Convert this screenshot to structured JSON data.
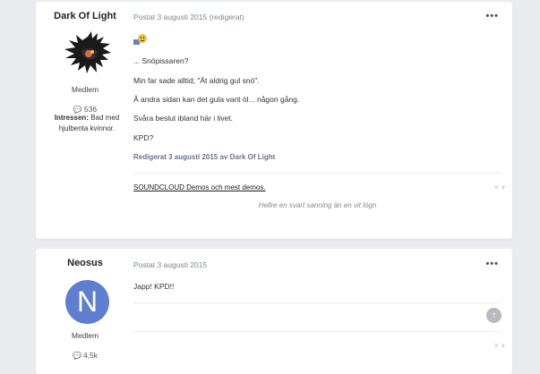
{
  "posts": [
    {
      "author": "Dark Of Light",
      "rank": "Medlem",
      "post_count": "536",
      "interests_label": "Intressen:",
      "interests_value": "Bad med hjulbenta kvinnor.",
      "meta": "Postat 3 augusti 2015 (redigerat)",
      "more": "•••",
      "lines": [
        "... Snöpissaren?",
        "Min far sade alltid; \"Ät aldrig gul snö\".",
        "Å andra sidan kan det gula varit öl... någon gång.",
        "Svåra beslut ibland här i livet.",
        "KPD?"
      ],
      "edited": "Redigerat 3 augusti 2015 av Dark Of Light",
      "signature_link": "SOUNDCLOUD Demos och mest demos.",
      "signature_quote": "Hellre en svart sanning än en vit lögn",
      "signature_controls": "✕ ▾"
    },
    {
      "author": "Neosus",
      "avatar_letter": "N",
      "rank": "Medlem",
      "post_count": "4,5k",
      "meta": "Postat 3 augusti 2015",
      "more": "•••",
      "lines": [
        "Japp! KPD!!"
      ],
      "signature_controls": "✕ ▾"
    }
  ],
  "colors": {
    "background": "#e9ebee",
    "avatar": "#5f7ed0",
    "edited": "#69748a"
  }
}
